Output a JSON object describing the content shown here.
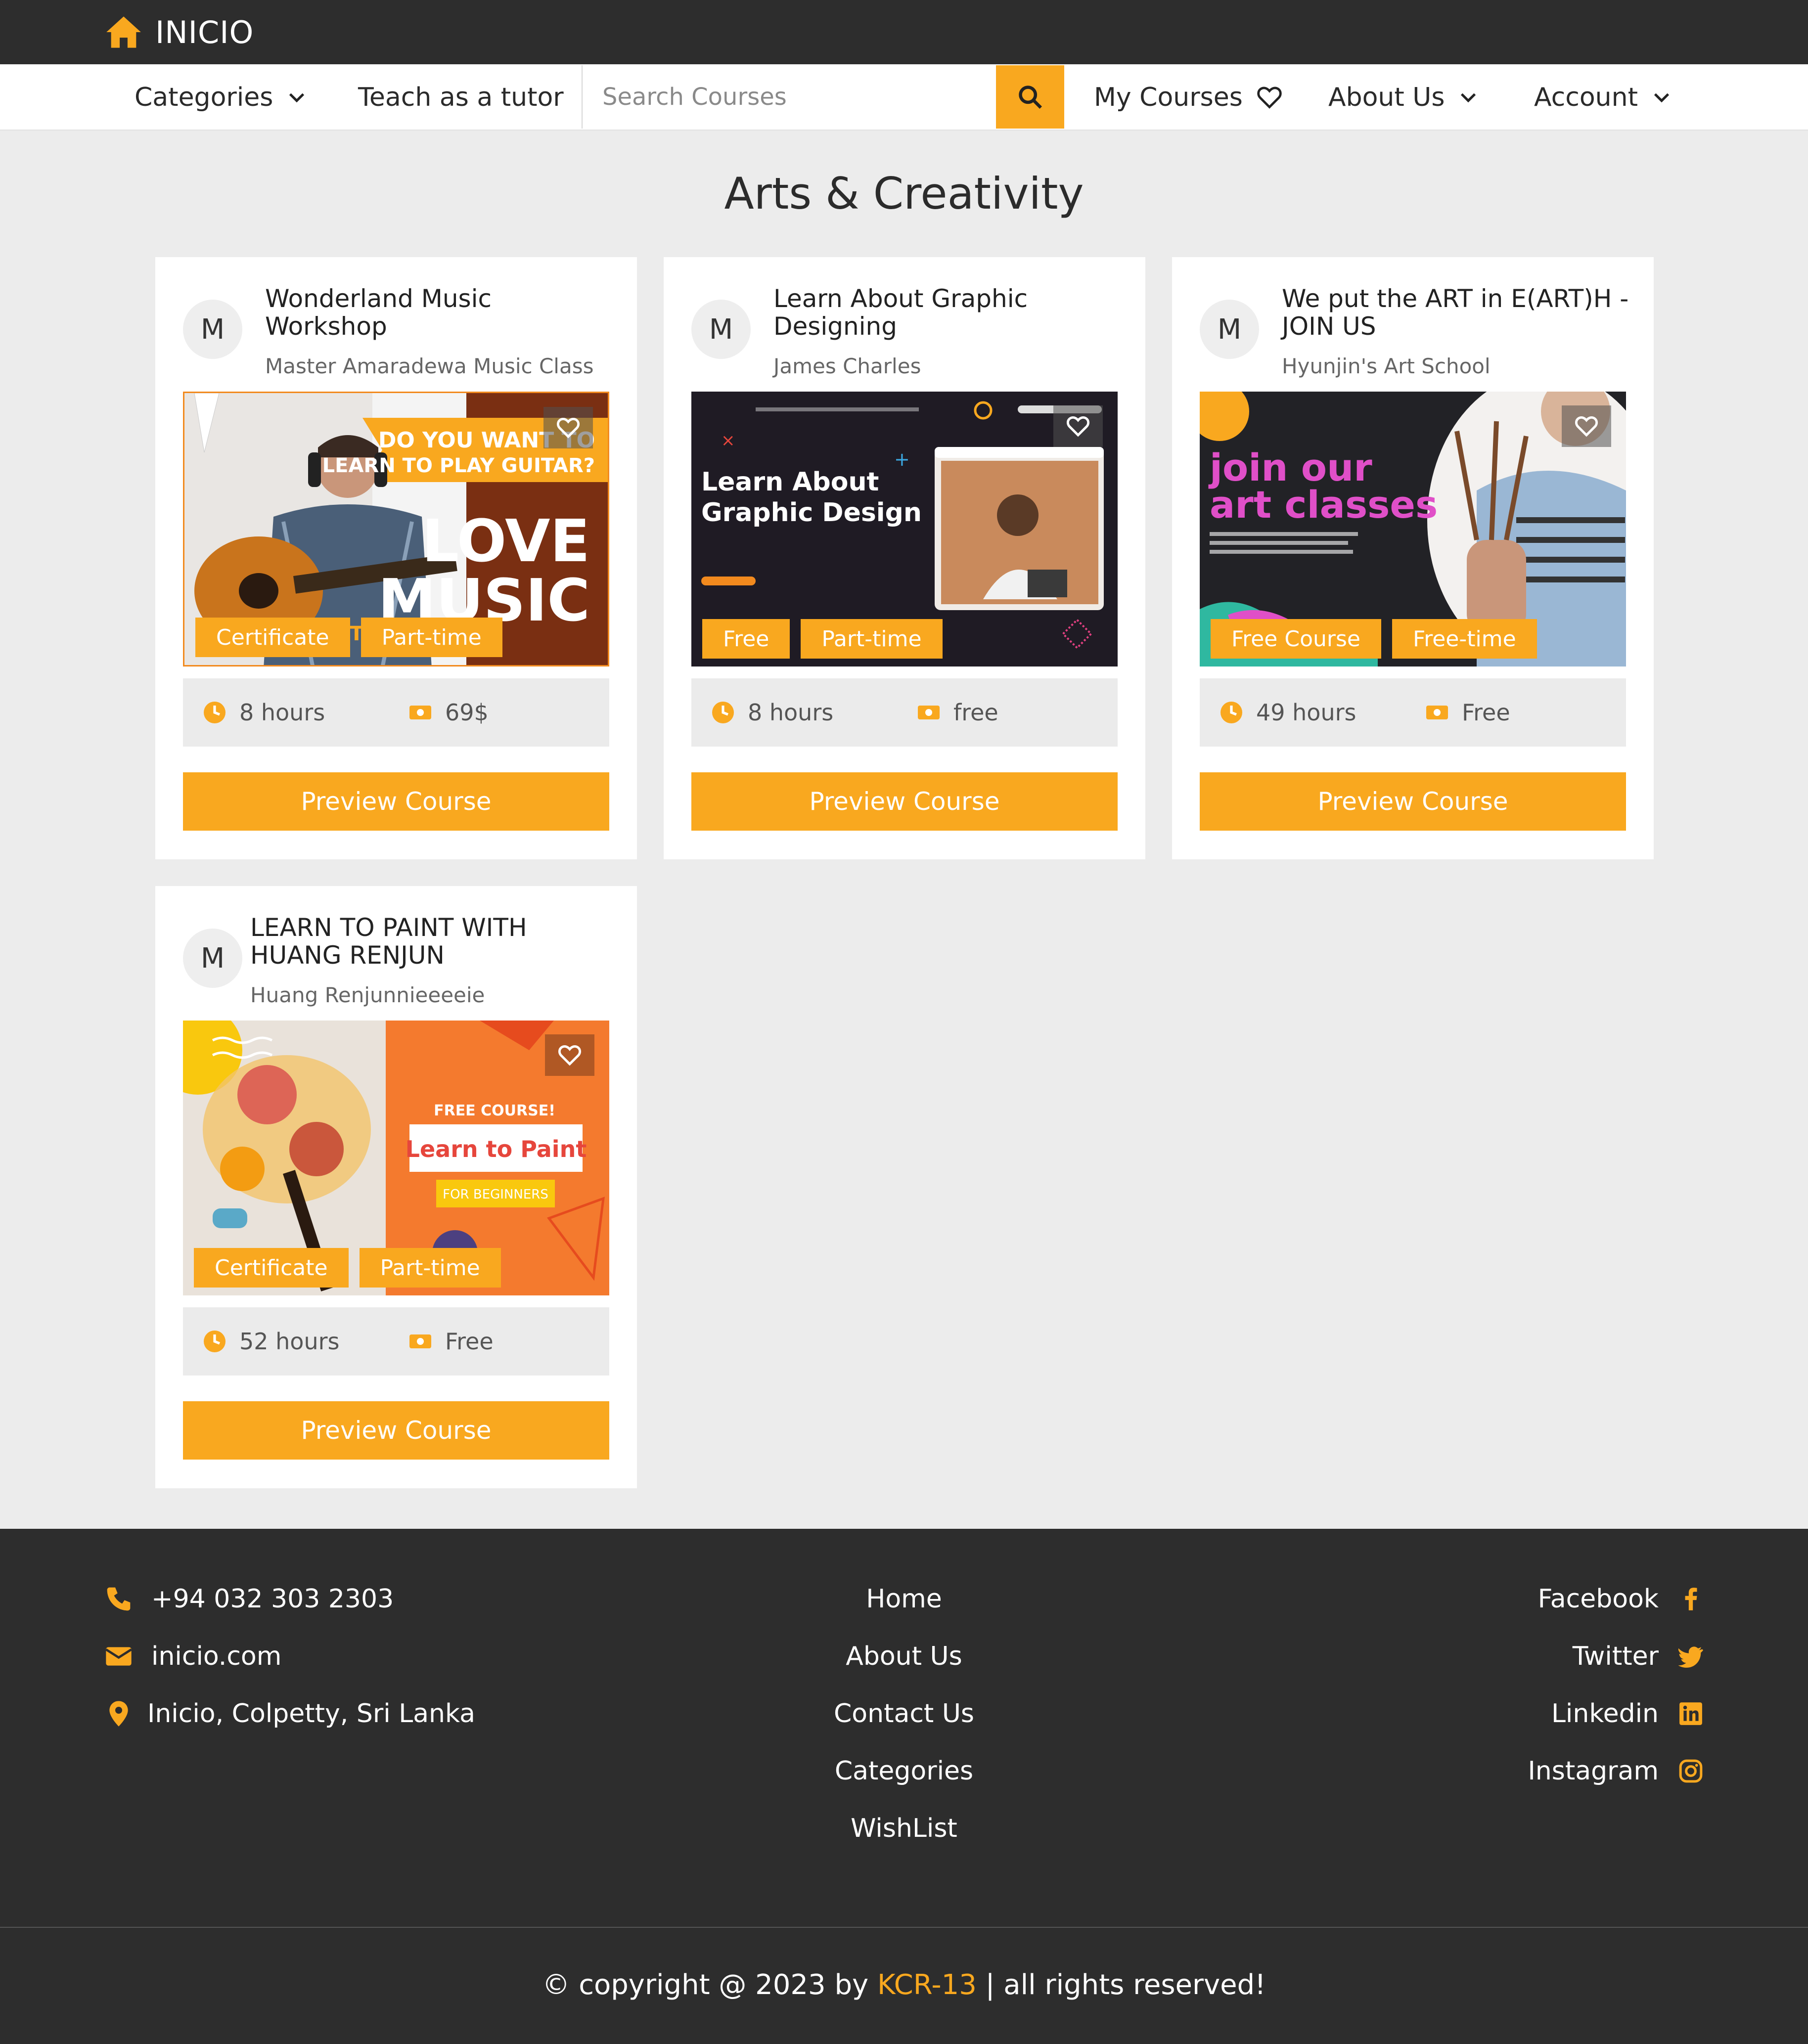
{
  "brand": {
    "name": "INICIO",
    "icon": "home-icon"
  },
  "nav": {
    "categories": "Categories",
    "teach": "Teach as a tutor",
    "search_placeholder": "Search Courses",
    "my_courses": "My Courses",
    "about": "About Us",
    "account": "Account"
  },
  "page": {
    "title": "Arts & Creativity"
  },
  "courses": [
    {
      "avatar": "M",
      "title": "Wonderland Music Workshop",
      "author": "Master Amaradewa Music Class",
      "image_text": [
        "DO YOU WANT TO LEARN TO PLAY GUITAR?",
        "LOVE MUSIC",
        "BEGINNER TUTORIAL"
      ],
      "tags": [
        "Certificate",
        "Part-time"
      ],
      "hours": "8 hours",
      "price": "69$",
      "button": "Preview Course"
    },
    {
      "avatar": "M",
      "title": "Learn About Graphic Designing",
      "author": "James Charles",
      "image_text": [
        "Learn About Graphic Design"
      ],
      "tags": [
        "Free",
        "Part-time"
      ],
      "hours": "8 hours",
      "price": "free",
      "button": "Preview Course"
    },
    {
      "avatar": "M",
      "title": "We put the ART in E(ART)H - JOIN US",
      "author": "Hyunjin's Art School",
      "image_text": [
        "join our art classes"
      ],
      "tags": [
        "Free Course",
        "Free-time"
      ],
      "hours": "49 hours",
      "price": "Free",
      "button": "Preview Course"
    },
    {
      "avatar": "M",
      "title": "LEARN TO PAINT WITH HUANG RENJUN",
      "author": "Huang Renjunnieeeeie",
      "image_text": [
        "FREE COURSE!",
        "Learn to Paint",
        "FOR BEGINNERS"
      ],
      "tags": [
        "Certificate",
        "Part-time"
      ],
      "hours": "52 hours",
      "price": "Free",
      "button": "Preview Course"
    }
  ],
  "footer": {
    "phone": "+94 032 303 2303",
    "email": "inicio.com",
    "address": "Inicio, Colpetty, Sri Lanka",
    "links": [
      "Home",
      "About Us",
      "Contact Us",
      "Categories",
      "WishList"
    ],
    "social": [
      "Facebook",
      "Twitter",
      "Linkedin",
      "Instagram"
    ],
    "copyright_prefix": "© copyright @ 2023 by",
    "copyright_brand": "KCR-13",
    "copyright_suffix": "| all rights reserved!"
  },
  "colors": {
    "accent": "#f9a81f",
    "dark": "#2d2d2d",
    "page_bg": "#ececec"
  }
}
